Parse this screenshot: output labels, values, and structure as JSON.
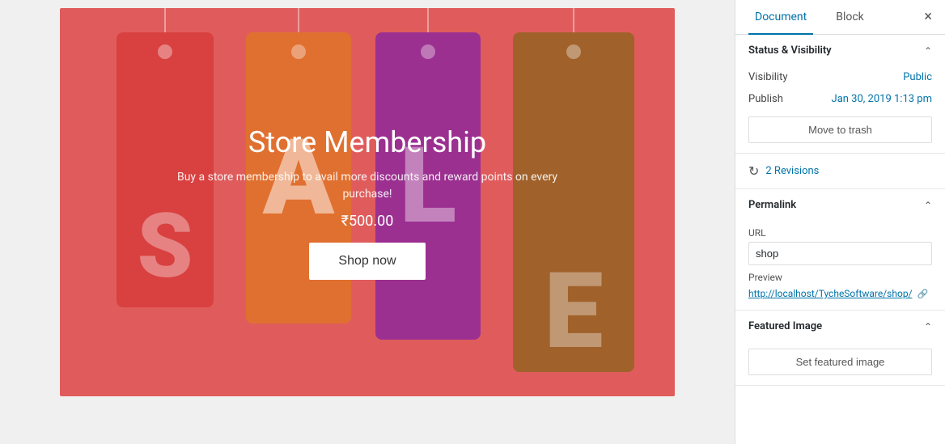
{
  "tabs": {
    "document": "Document",
    "block": "Block"
  },
  "close_icon": "×",
  "sections": {
    "status_visibility": {
      "title": "Status & Visibility",
      "visibility_label": "Visibility",
      "visibility_value": "Public",
      "publish_label": "Publish",
      "publish_value": "Jan 30, 2019 1:13 pm",
      "move_trash": "Move to trash"
    },
    "revisions": {
      "count": "2 Revisions"
    },
    "permalink": {
      "title": "Permalink",
      "url_label": "URL",
      "url_value": "shop",
      "preview_label": "Preview",
      "preview_link": "http://localhost/TycheSoftware/shop/"
    },
    "featured_image": {
      "title": "Featured Image",
      "set_button": "Set featured image"
    }
  },
  "banner": {
    "title": "Store Membership",
    "subtitle": "Buy a store membership to avail more discounts and reward points on every purchase!",
    "price": "₹500.00",
    "button": "Shop now",
    "letters": {
      "s": "S",
      "a": "A",
      "l": "L",
      "e": "E"
    }
  }
}
